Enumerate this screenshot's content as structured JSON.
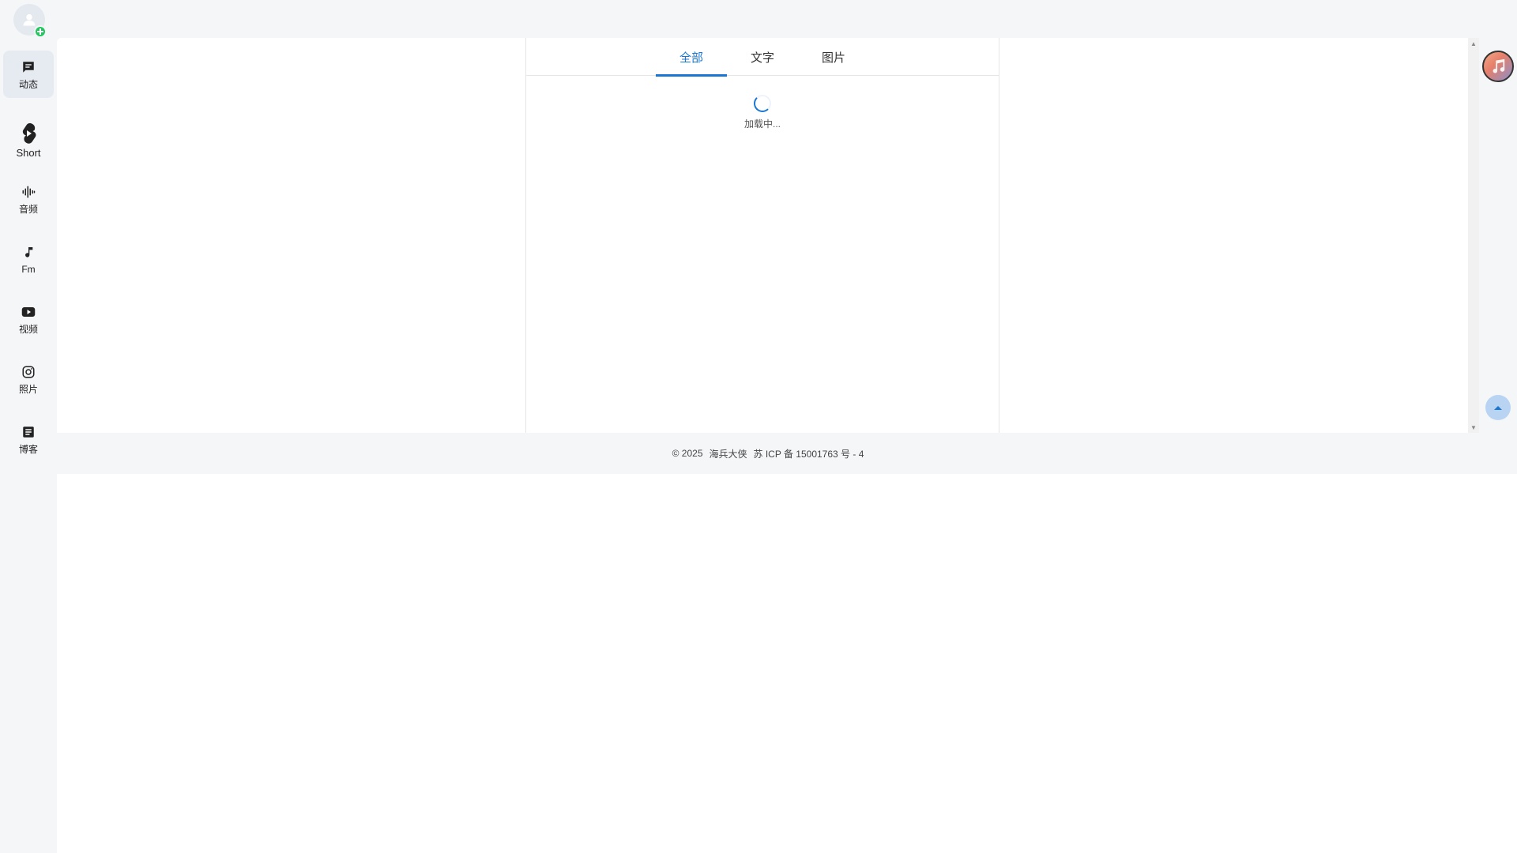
{
  "sidebar": {
    "items": [
      {
        "label": "动态",
        "icon": "message-icon",
        "active": true
      },
      {
        "label": "Short",
        "icon": "shorts-icon"
      },
      {
        "label": "音频",
        "icon": "audio-wave-icon"
      },
      {
        "label": "Fm",
        "icon": "music-note-icon"
      },
      {
        "label": "视频",
        "icon": "video-play-icon"
      },
      {
        "label": "照片",
        "icon": "camera-icon"
      },
      {
        "label": "博客",
        "icon": "article-icon"
      }
    ]
  },
  "tabs": [
    {
      "label": "全部",
      "active": true
    },
    {
      "label": "文字"
    },
    {
      "label": "图片"
    }
  ],
  "loading": {
    "text": "加载中..."
  },
  "footer": {
    "copyright": "© 2025",
    "owner": "海兵大侠",
    "icp": "苏 ICP 备 15001763 号 - 4"
  },
  "colors": {
    "accent": "#1976d2",
    "badge": "#22c55e"
  }
}
